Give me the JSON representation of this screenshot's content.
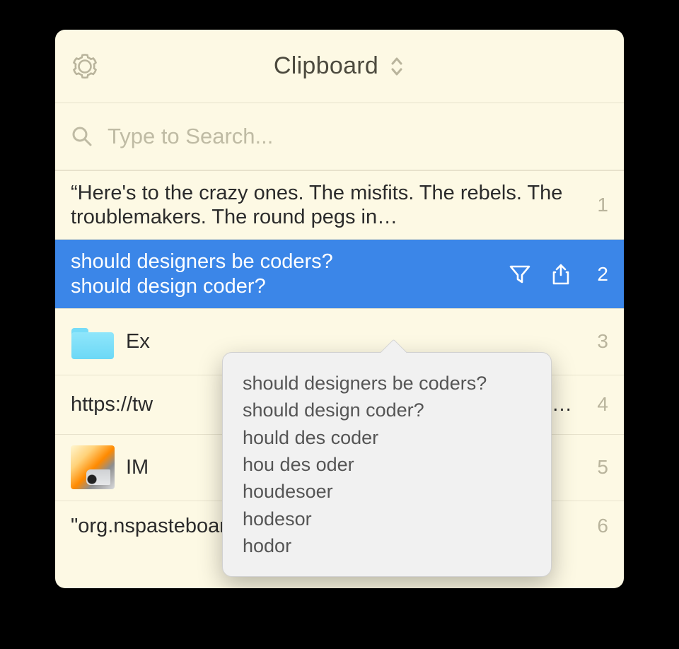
{
  "header": {
    "title": "Clipboard"
  },
  "search": {
    "placeholder": "Type to Search..."
  },
  "items": [
    {
      "text": "“Here's to the crazy ones. The misfits. The rebels. The troublemakers. The round pegs in…",
      "index": "1"
    },
    {
      "text": "should designers be coders?\nshould design coder?",
      "index": "2"
    },
    {
      "text": "Ex",
      "index": "3"
    },
    {
      "text": "https://tw                                                                                                   00064…",
      "index": "4"
    },
    {
      "text": "IM",
      "index": "5"
    },
    {
      "text": "\"org.nspasteboard.TransientType\",",
      "index": "6"
    }
  ],
  "popover": {
    "lines": [
      "should designers be coders?",
      "should design coder?",
      "hould des coder",
      "hou des oder",
      "houdesoer",
      "hodesor",
      "hodor"
    ]
  }
}
